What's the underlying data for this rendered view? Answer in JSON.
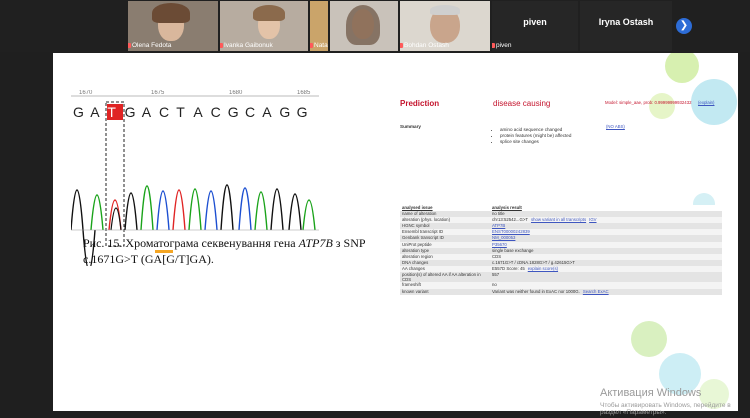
{
  "participants": [
    {
      "name": "Olena Fedota",
      "type": "video"
    },
    {
      "name": "Ivanka Gaibonuk",
      "type": "video"
    },
    {
      "name": "Nata",
      "type": "video"
    },
    {
      "name": "",
      "type": "video"
    },
    {
      "name": "Bohdan Ostash",
      "type": "video"
    },
    {
      "name": "piven",
      "type": "name-only"
    },
    {
      "name": "Iryna Ostash",
      "type": "name-only"
    }
  ],
  "next_icon": "chevron-right-icon",
  "slide": {
    "chromatogram": {
      "ruler_labels": [
        "1670",
        "1675",
        "1680",
        "1685"
      ],
      "sequence": [
        "G",
        "A",
        "T",
        "G",
        "A",
        "C",
        "T",
        "A",
        "C",
        "G",
        "C",
        "A",
        "G",
        "G"
      ],
      "highlight_index": 2,
      "highlight_color": "#e02424",
      "marker_color": "#f5a623"
    },
    "caption": {
      "prefix": "Рис. 15. Хроматограма секвенування гена ",
      "gene": "ATP7B",
      "suffix": " з SNP c.1671G>T (GA[G/T]GA)."
    },
    "prediction": {
      "title": "Prediction",
      "verdict": "disease causing",
      "model": "Model: simple_aae, prob: 0.99999999932432",
      "help": "(explain)",
      "summary_label": "Summary",
      "no_abs": "(NO ABS)",
      "bullets": [
        "amino acid sequence changed",
        "protein features (might be) affected",
        "splice site changes"
      ],
      "table": {
        "headers": [
          "analysed issue",
          "analysis result"
        ],
        "rows": [
          {
            "key": "name of alteration",
            "value": "no title"
          },
          {
            "key": "alteration (phys. location)",
            "value": "chr13:52542...G>T",
            "link": "show variant in all transcripts",
            "extra": "IGV"
          },
          {
            "key": "HGNC symbol",
            "value": "",
            "link": "ATP7B"
          },
          {
            "key": "Ensembl transcript ID",
            "value": "",
            "link": "ENST00000242839"
          },
          {
            "key": "Genbank transcript ID",
            "value": "",
            "link": "NM_000053"
          },
          {
            "key": "UniProt peptide",
            "value": "",
            "link": "P35670"
          },
          {
            "key": "alteration type",
            "value": "single base exchange"
          },
          {
            "key": "alteration region",
            "value": "CDS"
          },
          {
            "key": "DNA changes",
            "value": "c.1671G>T / cDNA.1828G>T / g.42615G>T"
          },
          {
            "key": "AA changes",
            "value": "E557D Score: 45",
            "link": "explain score(s)"
          },
          {
            "key": "position(s) of altered AA if AA alteration in CDS",
            "value": "557"
          },
          {
            "key": "frameshift",
            "value": "no"
          },
          {
            "key": "known variant",
            "value": "Variant was neither found in ExAC nor 1000G.",
            "link": "Search ExAC"
          }
        ]
      }
    }
  },
  "watermark": {
    "line1": "Активация Windows",
    "line2": "Чтобы активировать Windows, перейдите в раздел «Параметры»."
  }
}
